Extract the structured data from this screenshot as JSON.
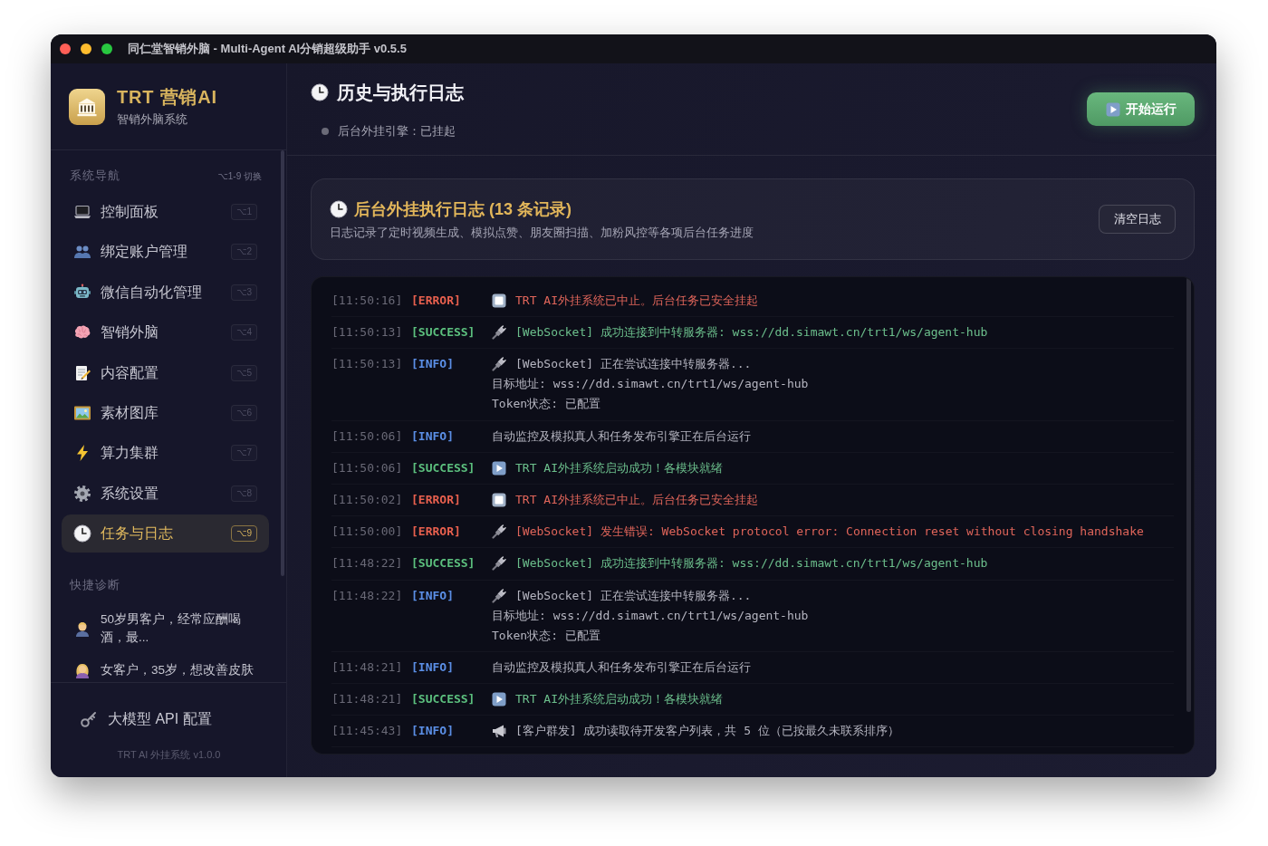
{
  "window": {
    "title": "同仁堂智销外脑 - Multi-Agent AI分销超级助手 v0.5.5"
  },
  "sidebar": {
    "brand": {
      "name": "TRT 营销AI",
      "subtitle": "智销外脑系统"
    },
    "nav": {
      "heading": "系统导航",
      "hint": "⌥1-9 切换",
      "items": [
        {
          "label": "控制面板",
          "shortcut": "⌥1",
          "selected": false
        },
        {
          "label": "绑定账户管理",
          "shortcut": "⌥2",
          "selected": false
        },
        {
          "label": "微信自动化管理",
          "shortcut": "⌥3",
          "selected": false
        },
        {
          "label": "智销外脑",
          "shortcut": "⌥4",
          "selected": false
        },
        {
          "label": "内容配置",
          "shortcut": "⌥5",
          "selected": false
        },
        {
          "label": "素材图库",
          "shortcut": "⌥6",
          "selected": false
        },
        {
          "label": "算力集群",
          "shortcut": "⌥7",
          "selected": false
        },
        {
          "label": "系统设置",
          "shortcut": "⌥8",
          "selected": false
        },
        {
          "label": "任务与日志",
          "shortcut": "⌥9",
          "selected": true
        }
      ]
    },
    "quick": {
      "heading": "快捷诊断",
      "items": [
        {
          "text": "50岁男客户，经常应酬喝酒，最..."
        },
        {
          "text": "女客户，35岁，想改善皮肤"
        }
      ]
    },
    "api_config": "大模型 API 配置",
    "version": "TRT AI 外挂系统 v1.0.0"
  },
  "header": {
    "title": "历史与执行日志",
    "status": {
      "text": "后台外挂引擎：已挂起",
      "on": false
    },
    "run_button": "开始运行"
  },
  "log_card": {
    "title": "后台外挂执行日志 (13 条记录)",
    "description": "日志记录了定时视频生成、模拟点赞、朋友圈扫描、加粉风控等各项后台任务进度",
    "clear_button": "清空日志"
  },
  "log": [
    {
      "time": "[11:50:16]",
      "level": "[ERROR]",
      "kind": "halt",
      "lines": [
        "TRT AI外挂系统已中止。后台任务已安全挂起"
      ]
    },
    {
      "time": "[11:50:13]",
      "level": "[SUCCESS]",
      "kind": "connected",
      "lines": [
        "[WebSocket] 成功连接到中转服务器: wss://dd.simawt.cn/trt1/ws/agent-hub"
      ]
    },
    {
      "time": "[11:50:13]",
      "level": "[INFO]",
      "kind": "connecting",
      "lines": [
        "[WebSocket] 正在尝试连接中转服务器...",
        "目标地址: wss://dd.simawt.cn/trt1/ws/agent-hub",
        "Token状态: 已配置"
      ]
    },
    {
      "time": "[11:50:06]",
      "level": "[INFO]",
      "kind": "note",
      "lines": [
        "自动监控及模拟真人和任务发布引擎正在后台运行"
      ]
    },
    {
      "time": "[11:50:06]",
      "level": "[SUCCESS]",
      "kind": "launch",
      "lines": [
        "TRT AI外挂系统启动成功！各模块就绪"
      ]
    },
    {
      "time": "[11:50:02]",
      "level": "[ERROR]",
      "kind": "halt",
      "lines": [
        "TRT AI外挂系统已中止。后台任务已安全挂起"
      ]
    },
    {
      "time": "[11:50:00]",
      "level": "[ERROR]",
      "kind": "fault",
      "lines": [
        "[WebSocket] 发生错误: WebSocket protocol error: Connection reset without closing handshake"
      ]
    },
    {
      "time": "[11:48:22]",
      "level": "[SUCCESS]",
      "kind": "connected",
      "lines": [
        "[WebSocket] 成功连接到中转服务器: wss://dd.simawt.cn/trt1/ws/agent-hub"
      ]
    },
    {
      "time": "[11:48:22]",
      "level": "[INFO]",
      "kind": "connecting",
      "lines": [
        "[WebSocket] 正在尝试连接中转服务器...",
        "目标地址: wss://dd.simawt.cn/trt1/ws/agent-hub",
        "Token状态: 已配置"
      ]
    },
    {
      "time": "[11:48:21]",
      "level": "[INFO]",
      "kind": "note",
      "lines": [
        "自动监控及模拟真人和任务发布引擎正在后台运行"
      ]
    },
    {
      "time": "[11:48:21]",
      "level": "[SUCCESS]",
      "kind": "launch",
      "lines": [
        "TRT AI外挂系统启动成功！各模块就绪"
      ]
    },
    {
      "time": "[11:45:43]",
      "level": "[INFO]",
      "kind": "broadcast",
      "lines": [
        "[客户群发] 成功读取待开发客户列表，共 5 位（已按最久未联系排序）"
      ]
    }
  ]
}
